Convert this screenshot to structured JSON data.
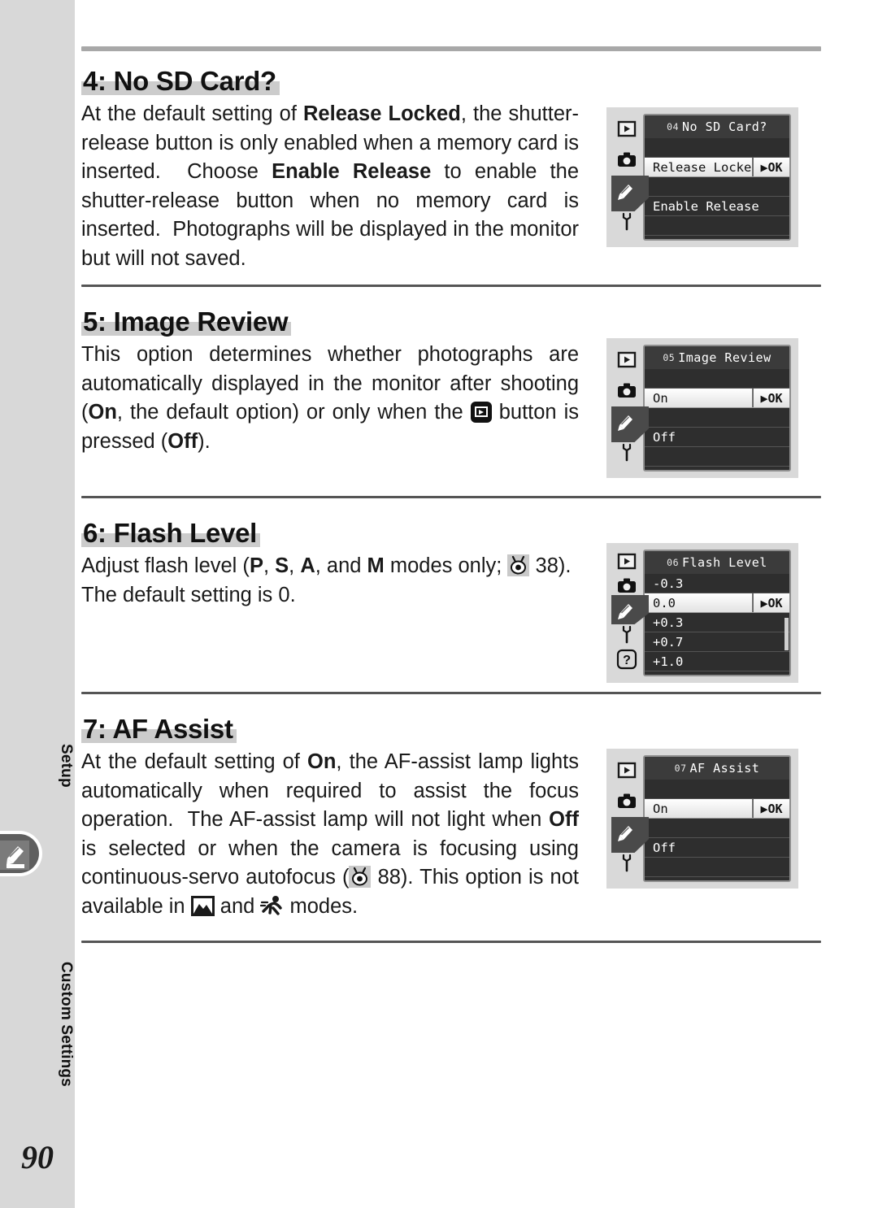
{
  "page": {
    "number": "90",
    "tabs": {
      "upper": "Setup",
      "lower": "Custom Settings",
      "marker_icon": "pencil-icon"
    }
  },
  "sections": [
    {
      "id": "no-sd-card",
      "heading": "4: No SD Card?",
      "body_html": "At the default setting of <b>Release Locked</b>, the shutter-release button is only enabled when a memory card is inserted.&nbsp; Choose <b>Enable Release</b> to enable the shutter-release button when no memory card is inserted.&nbsp; Photographs will be displayed in the monitor but will not saved.",
      "lcd": {
        "menu_number": "04",
        "title": "No SD Card?",
        "side_icons": [
          "playback-icon",
          "camera-icon",
          "pencil-icon",
          "wrench-icon"
        ],
        "selected_side_index": 2,
        "scrollbar": false,
        "rows": [
          {
            "label": "",
            "blank": true,
            "selected": false,
            "ok": ""
          },
          {
            "label": "Release Locke",
            "blank": false,
            "selected": true,
            "ok": "▶OK"
          },
          {
            "label": "",
            "blank": true,
            "selected": false,
            "ok": ""
          },
          {
            "label": "Enable Release",
            "blank": false,
            "selected": false,
            "ok": ""
          },
          {
            "label": "",
            "blank": true,
            "selected": false,
            "ok": ""
          }
        ]
      }
    },
    {
      "id": "image-review",
      "heading": "5: Image Review",
      "body_html": "This option determines whether photographs are automatically displayed in the monitor after shooting (<b>On</b>, the default option) or only when the __PLAY__ button is pressed (<b>Off</b>).",
      "lcd": {
        "menu_number": "05",
        "title": "Image Review",
        "side_icons": [
          "playback-icon",
          "camera-icon",
          "pencil-icon",
          "wrench-icon"
        ],
        "selected_side_index": 2,
        "scrollbar": false,
        "rows": [
          {
            "label": "",
            "blank": true,
            "selected": false,
            "ok": ""
          },
          {
            "label": "On",
            "blank": false,
            "selected": true,
            "ok": "▶OK"
          },
          {
            "label": "",
            "blank": true,
            "selected": false,
            "ok": ""
          },
          {
            "label": "Off",
            "blank": false,
            "selected": false,
            "ok": ""
          },
          {
            "label": "",
            "blank": true,
            "selected": false,
            "ok": ""
          }
        ]
      }
    },
    {
      "id": "flash-level",
      "heading": "6: Flash Level",
      "body_html": "Adjust flash level (<b>P</b>, <b>S</b>, <b>A</b>, and <b>M</b> modes only; __REF__ 38).&nbsp; The default setting is 0.",
      "lcd": {
        "menu_number": "06",
        "title": "Flash Level",
        "side_icons": [
          "playback-icon",
          "camera-icon",
          "pencil-icon",
          "wrench-icon",
          "help-icon"
        ],
        "selected_side_index": 2,
        "scrollbar": true,
        "rows": [
          {
            "label": "-0.3",
            "blank": false,
            "selected": false,
            "ok": ""
          },
          {
            "label": "0.0",
            "blank": false,
            "selected": true,
            "ok": "▶OK"
          },
          {
            "label": "+0.3",
            "blank": false,
            "selected": false,
            "ok": ""
          },
          {
            "label": "+0.7",
            "blank": false,
            "selected": false,
            "ok": ""
          },
          {
            "label": "+1.0",
            "blank": false,
            "selected": false,
            "ok": ""
          }
        ]
      }
    },
    {
      "id": "af-assist",
      "heading": "7: AF Assist",
      "body_html": "At the default setting of <b>On</b>, the AF-assist lamp lights automatically when required to assist the focus operation.&nbsp; The AF-assist lamp will not light when <b>Off</b> is selected or when the camera is focusing using continuous-servo autofocus (__REF__ 88). This option is not available in __LAND__ and __SPORT__ modes.",
      "lcd": {
        "menu_number": "07",
        "title": "AF Assist",
        "side_icons": [
          "playback-icon",
          "camera-icon",
          "pencil-icon",
          "wrench-icon"
        ],
        "selected_side_index": 2,
        "scrollbar": false,
        "rows": [
          {
            "label": "",
            "blank": true,
            "selected": false,
            "ok": ""
          },
          {
            "label": "On",
            "blank": false,
            "selected": true,
            "ok": "▶OK"
          },
          {
            "label": "",
            "blank": true,
            "selected": false,
            "ok": ""
          },
          {
            "label": "Off",
            "blank": false,
            "selected": false,
            "ok": ""
          },
          {
            "label": "",
            "blank": true,
            "selected": false,
            "ok": ""
          }
        ]
      }
    }
  ],
  "colors": {
    "edge_band": "#d8d8d8",
    "heading_highlight": "#cccccc",
    "top_rule": "#a8a8a8",
    "section_rule": "#555555",
    "lcd_background": "#d9d9d9",
    "lcd_panel": "#3b3b3b",
    "lcd_row": "#2e2e2e",
    "lcd_selected": "#ffffff"
  }
}
